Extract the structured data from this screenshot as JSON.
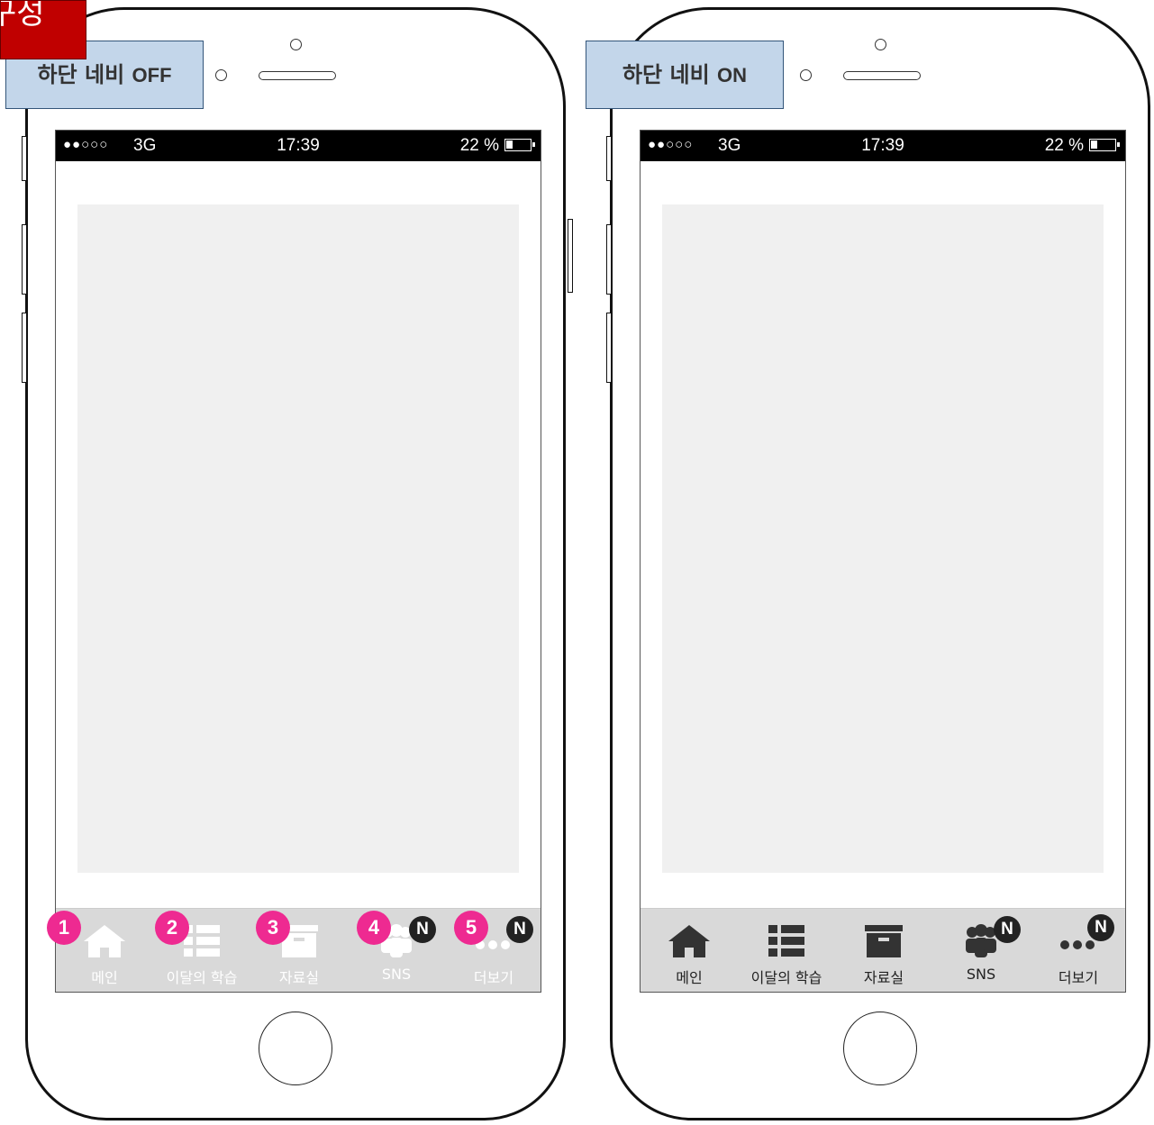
{
  "corner_tag": "구성",
  "left": {
    "caption_ko": "하단 네비",
    "caption_en": "OFF",
    "status": {
      "signal": "●●○○○",
      "network": "3G",
      "time": "17:39",
      "battery": "22 %"
    },
    "tabs": [
      {
        "label": "메인",
        "icon": "home-icon",
        "marker": "1"
      },
      {
        "label": "이달의 학습",
        "icon": "list-icon",
        "marker": "2"
      },
      {
        "label": "자료실",
        "icon": "archive-icon",
        "marker": "3"
      },
      {
        "label": "SNS",
        "icon": "people-icon",
        "marker": "4",
        "badge": "N"
      },
      {
        "label": "더보기",
        "icon": "more-icon",
        "marker": "5",
        "badge": "N"
      }
    ]
  },
  "right": {
    "caption_ko": "하단 네비",
    "caption_en": "ON",
    "status": {
      "signal": "●●○○○",
      "network": "3G",
      "time": "17:39",
      "battery": "22 %"
    },
    "tabs": [
      {
        "label": "메인",
        "icon": "home-icon"
      },
      {
        "label": "이달의 학습",
        "icon": "list-icon"
      },
      {
        "label": "자료실",
        "icon": "archive-icon"
      },
      {
        "label": "SNS",
        "icon": "people-icon",
        "badge": "N"
      },
      {
        "label": "더보기",
        "icon": "more-icon",
        "badge": "N"
      }
    ]
  },
  "colors": {
    "tabbar_bg": "#d9d9d9",
    "content_bg": "#f0f0f0",
    "marker": "#ee2a91",
    "label_box": "#c3d6ea",
    "corner_tag": "#c00000"
  }
}
